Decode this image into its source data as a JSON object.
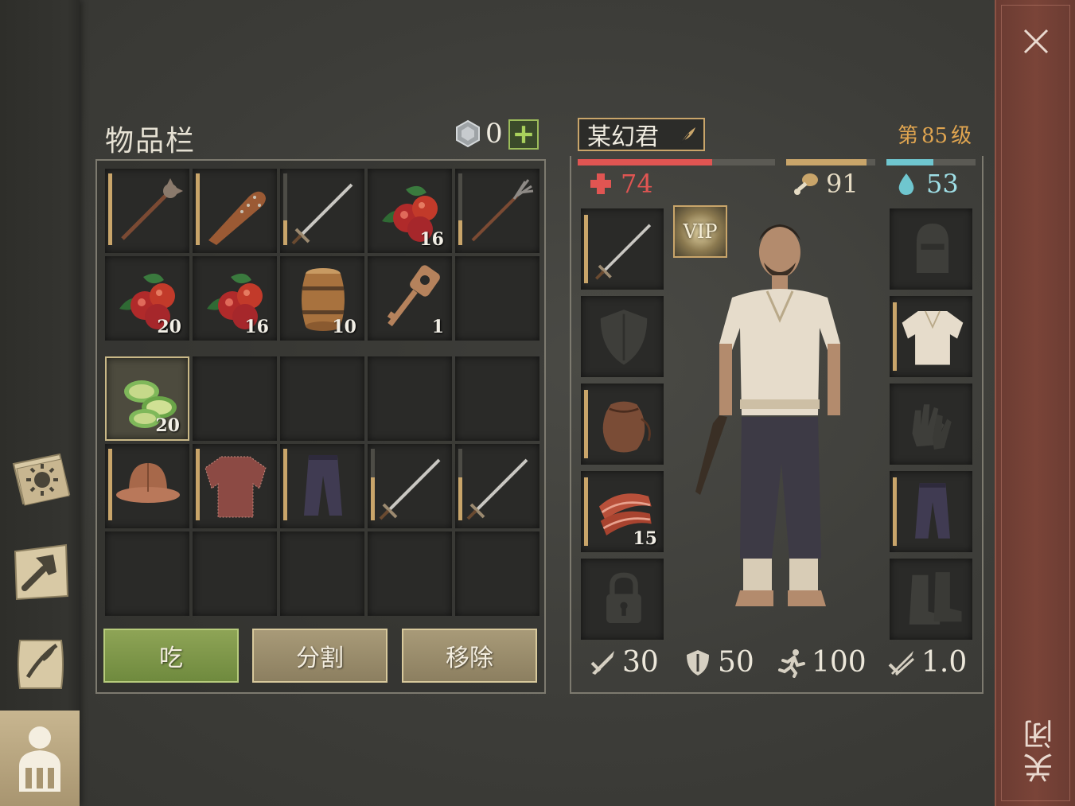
{
  "inventory": {
    "title": "物品栏",
    "coins": "0",
    "rows": [
      [
        {
          "icon": "mace-icon",
          "qty": "",
          "durability": 1.0
        },
        {
          "icon": "spiked-club-icon",
          "qty": "",
          "durability": 1.0
        },
        {
          "icon": "sword-icon",
          "qty": "",
          "durability": 0.35
        },
        {
          "icon": "berries-icon",
          "qty": "16",
          "durability": null
        },
        {
          "icon": "pitchfork-icon",
          "qty": "",
          "durability": 0.35
        }
      ],
      [
        {
          "icon": "berries-icon",
          "qty": "20",
          "durability": null
        },
        {
          "icon": "berries-icon",
          "qty": "16",
          "durability": null
        },
        {
          "icon": "barrel-icon",
          "qty": "10",
          "durability": null
        },
        {
          "icon": "key-icon",
          "qty": "1",
          "durability": null
        },
        {
          "icon": "",
          "qty": "",
          "durability": null
        }
      ]
    ],
    "lower_rows": [
      [
        {
          "icon": "cucumber-slices-icon",
          "qty": "20",
          "durability": null,
          "selected": true
        },
        {
          "icon": "",
          "qty": "",
          "durability": null
        },
        {
          "icon": "",
          "qty": "",
          "durability": null
        },
        {
          "icon": "",
          "qty": "",
          "durability": null
        },
        {
          "icon": "",
          "qty": "",
          "durability": null
        }
      ],
      [
        {
          "icon": "helmet-icon",
          "qty": "",
          "durability": 1.0
        },
        {
          "icon": "chainmail-icon",
          "qty": "",
          "durability": 1.0
        },
        {
          "icon": "pants-icon",
          "qty": "",
          "durability": 1.0
        },
        {
          "icon": "sword-icon",
          "qty": "",
          "durability": 0.6
        },
        {
          "icon": "sword-icon",
          "qty": "",
          "durability": 0.6
        }
      ],
      [
        {
          "icon": "",
          "qty": "",
          "durability": null
        },
        {
          "icon": "",
          "qty": "",
          "durability": null
        },
        {
          "icon": "",
          "qty": "",
          "durability": null
        },
        {
          "icon": "",
          "qty": "",
          "durability": null
        },
        {
          "icon": "",
          "qty": "",
          "durability": null
        }
      ]
    ],
    "actions": {
      "eat": "吃",
      "split": "分割",
      "remove": "移除"
    }
  },
  "character": {
    "name": "某幻君",
    "level_prefix": "第",
    "level": "85",
    "level_suffix": "级",
    "health": "74",
    "hunger": "91",
    "thirst": "53",
    "health_fraction": 0.68,
    "hunger_fraction": 0.9,
    "thirst_fraction": 0.53,
    "vip": "VIP",
    "equipment_left": [
      {
        "icon": "sword-icon",
        "qty": ""
      },
      {
        "icon": "shield-icon",
        "qty": ""
      },
      {
        "icon": "pouch-icon",
        "qty": ""
      },
      {
        "icon": "meat-icon",
        "qty": "15"
      },
      {
        "icon": "lock-icon",
        "qty": ""
      }
    ],
    "equipment_right": [
      {
        "icon": "helmet-placeholder-icon",
        "qty": ""
      },
      {
        "icon": "shirt-icon",
        "qty": ""
      },
      {
        "icon": "gloves-placeholder-icon",
        "qty": ""
      },
      {
        "icon": "pants-icon",
        "qty": ""
      },
      {
        "icon": "boots-placeholder-icon",
        "qty": ""
      }
    ],
    "attack": "30",
    "defense": "50",
    "speed": "100",
    "weight": "1.0"
  },
  "close_label": "关闭",
  "colors": {
    "health": "#e05552",
    "hunger": "#c9a56a",
    "thirst": "#6fc6cf",
    "level": "#e0a550"
  }
}
